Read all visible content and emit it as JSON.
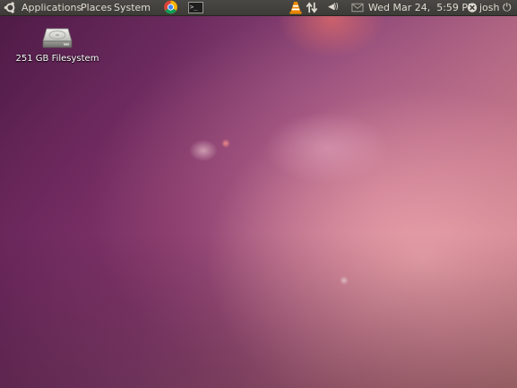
{
  "top_panel": {
    "menus": {
      "applications": "Applications",
      "places": "Places",
      "system": "System"
    },
    "launchers": {
      "browser_icon": "chrome-icon",
      "terminal_icon": "terminal-icon",
      "terminal_glyph": ">_"
    },
    "tray": {
      "vlc_icon": "vlc-cone-icon",
      "network_icon": "network-transfer-icon",
      "volume_icon": "speaker-icon",
      "volume_glyph": "◀))",
      "mail_icon": "envelope-icon",
      "clock": "Wed Mar 24,  5:59 PM",
      "user_icon": "user-status-icon",
      "user": "josh",
      "power_icon": "power-icon",
      "power_glyph": "⏻"
    },
    "colors": {
      "panel_bg": "#3c3b37",
      "panel_text": "#dfdbd2"
    }
  },
  "desktop": {
    "icons": [
      {
        "icon": "hard-drive-icon",
        "label": "251 GB Filesystem"
      }
    ]
  }
}
